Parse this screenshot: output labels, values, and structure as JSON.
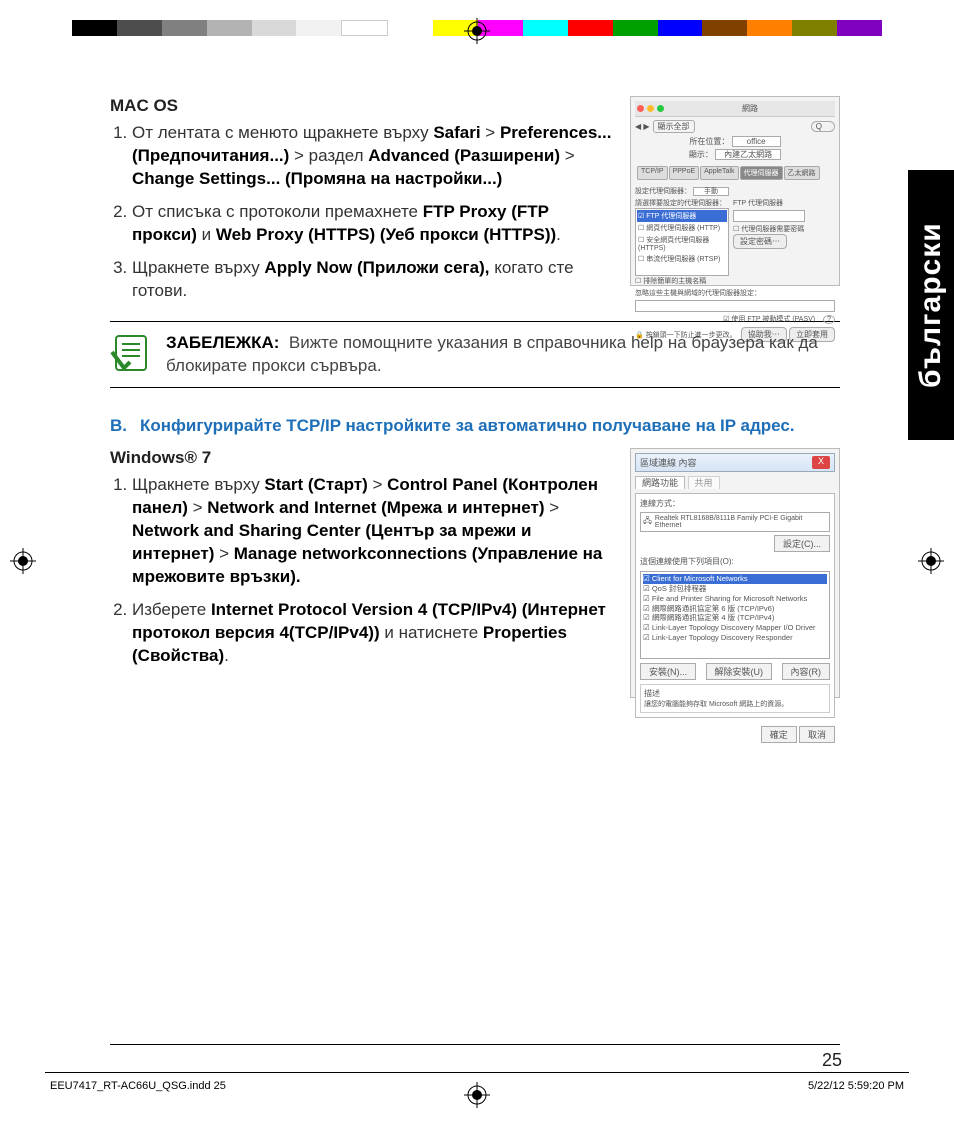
{
  "colorbar": {
    "left": [
      "#000000",
      "#4d4d4d",
      "#808080",
      "#b3b3b3",
      "#d9d9d9",
      "#f2f2f2",
      "#ffffff"
    ],
    "right": [
      "#ffff00",
      "#ff00ff",
      "#00ffff",
      "#ff0000",
      "#00ff00",
      "#0000ff",
      "#804000",
      "#ff8000",
      "#808000",
      "#400080"
    ]
  },
  "side_tab": "български",
  "macos": {
    "heading": "MAC OS",
    "items": [
      {
        "pre1": "От лентата с менюто щракнете върху ",
        "b1": "Safari",
        "sep1": " > ",
        "b2": "Preferences... (Предпочитания...)",
        "sep2": " > раздел ",
        "b3": "Advanced (Разширени)",
        "sep3": " > ",
        "b4": "Change Settings... (Промяна на настройки...)"
      },
      {
        "pre1": "От списъка с протоколи премахнете ",
        "b1": "FTP Proxy (FTP прокси)",
        "sep1": " и ",
        "b2": "Web Proxy (HTTPS) (Уеб прокси (HTTPS))",
        "post": "."
      },
      {
        "pre1": "Щракнете върху ",
        "b1": "Apply Now (Приложи сега),",
        "post": " когато сте готови."
      }
    ]
  },
  "mac_thumb": {
    "title": "網路",
    "window_buttons": [
      "#ff5f57",
      "#febc2e",
      "#28c840"
    ],
    "nav_back": "◀ ▶",
    "nav_all": "顯示全部",
    "search_placeholder": "Q",
    "row1_label": "所在位置：",
    "row1_value": "office",
    "row2_label": "顯示：",
    "row2_value": "內建乙太網路",
    "tabs": [
      "TCP/IP",
      "PPPoE",
      "AppleTalk",
      "代理伺服器",
      "乙太網路"
    ],
    "active_tab": "代理伺服器",
    "proxy_label": "設定代理伺服器：",
    "proxy_value": "手動",
    "left_caption": "請選擇要設定的代理伺服器：",
    "right_caption": "FTP 代理伺服器",
    "proxy_list": [
      "FTP 代理伺服器",
      "網頁代理伺服器 (HTTP)",
      "安全網頁代理伺服器 (HTTPS)",
      "串流代理伺服器 (RTSP)"
    ],
    "selected_proxy": "FTP 代理伺服器",
    "unchecked_row": "排除簡單的主機名稱",
    "auth_label": "代理伺服器需要密碼",
    "auth_btn": "設定密碼⋯",
    "bypass_label": "忽略這些主機與網域的代理伺服器設定：",
    "pasv_label": "使用 FTP 被動模式 (PASV)",
    "help_btn": "?",
    "lock_label": "按鎖頭一下防止進一步更改。",
    "assist_btn": "協助我⋯",
    "apply_btn": "立即套用"
  },
  "note": {
    "label": "ЗАБЕЛЕЖКА:",
    "text": "Вижте помощните указания в справочника help на браузера как да блокирате прокси сървъра."
  },
  "section_b": {
    "letter": "B.",
    "title": "Конфигурирайте TCP/IP настройките за автоматично получаване на IP адрес."
  },
  "win7": {
    "heading": "Windows® 7",
    "items": [
      {
        "pre1": "Щракнете върху ",
        "b1": "Start (Старт)",
        "sep1": " > ",
        "b2": "Control Panel (Контролен панел)",
        "sep2": " > ",
        "b3": "Network and Internet (Мрежа и интернет)",
        "sep3": " > ",
        "b4": "Network and Sharing Center (Център за мрежи и интернет)",
        "sep4": " > ",
        "b5": "Manage networkconnections (Управление на мрежовите връзки)."
      },
      {
        "pre1": "Изберете ",
        "b1": "Internet Protocol Version 4 (TCP/IPv4) (Интернет протокол версия 4(TCP/IPv4))",
        "sep1": " и натиснете ",
        "b2": "Properties (Свойства)",
        "post": "."
      }
    ]
  },
  "win_thumb": {
    "title": "區域連線 內容",
    "close": "X",
    "tab1": "網路功能",
    "tab2": "共用",
    "connect_label": "連線方式：",
    "adapter": "Realtek RTL8168B/8111B Family PCI-E Gigabit Ethernet",
    "config_btn": "設定(C)...",
    "uses_label": "這個連線使用下列項目(O):",
    "protocols": [
      "Client for Microsoft Networks",
      "QoS 封包排程器",
      "File and Printer Sharing for Microsoft Networks",
      "網際網路通訊協定第 6 版 (TCP/IPv6)",
      "網際網路通訊協定第 4 版 (TCP/IPv4)",
      "Link-Layer Topology Discovery Mapper I/O Driver",
      "Link-Layer Topology Discovery Responder"
    ],
    "selected_protocol": "Client for Microsoft Networks",
    "install_btn": "安裝(N)...",
    "uninstall_btn": "解除安裝(U)",
    "props_btn": "內容(R)",
    "desc_label": "描述",
    "desc_text": "讓您的電腦能夠存取 Microsoft 網路上的資源。",
    "ok_btn": "確定",
    "cancel_btn": "取消"
  },
  "page_number": "25",
  "footer": {
    "left": "EEU7417_RT-AC66U_QSG.indd   25",
    "right": "5/22/12   5:59:20 PM"
  }
}
